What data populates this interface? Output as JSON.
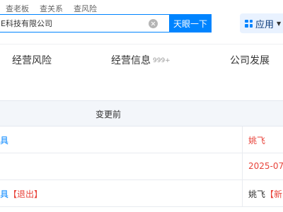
{
  "search_tabs": [
    "查老板",
    "查关系",
    "查风险"
  ],
  "search": {
    "value": "E科技有限公司",
    "button_label": "天眼一下"
  },
  "apps_button": {
    "label": "应用"
  },
  "subnav": {
    "items": [
      {
        "label": "经营风险"
      },
      {
        "label": "经营信息",
        "count": "999+"
      },
      {
        "label": "公司发展"
      }
    ]
  },
  "table": {
    "header_before": "变更前",
    "rows": [
      {
        "left": "具",
        "right": "姚飞"
      },
      {
        "left": "",
        "right": "2025-07-"
      },
      {
        "left": "具",
        "left_tag": "【退出】",
        "right": "姚飞",
        "right_tag": "【新"
      }
    ]
  },
  "colors": {
    "primary": "#0084ff",
    "red": "#e8443b",
    "table_header_bg": "#f3f6fa",
    "apps_bg": "#e9f2ff"
  }
}
